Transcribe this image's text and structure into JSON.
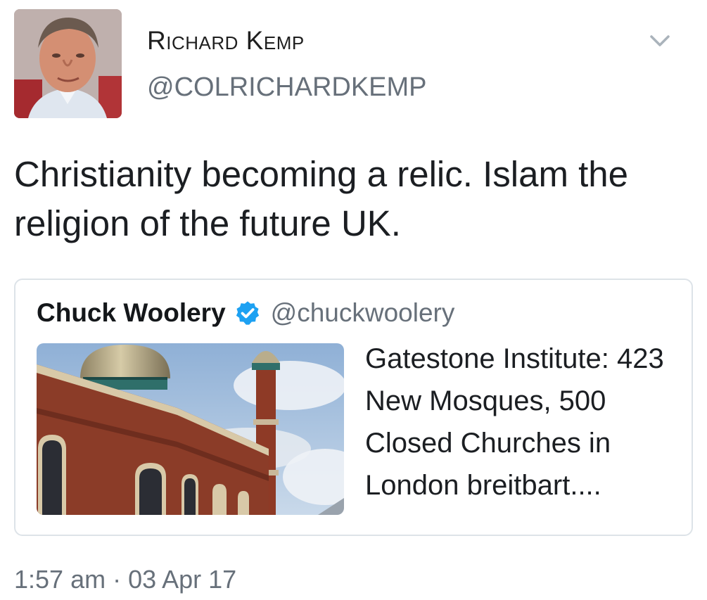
{
  "tweet": {
    "author": {
      "name": "Richard Kemp",
      "handle": "@COLRICHARDKEMP"
    },
    "text": "Christianity becoming a relic. Islam the religion of the future UK.",
    "timestamp": "1:57 am · 03 Apr 17",
    "menu_icon": "chevron-down-icon",
    "quoted": {
      "name": "Chuck Woolery",
      "verified": true,
      "verified_icon": "verified-badge-icon",
      "handle": "@chuckwoolery",
      "link_text": "Gatestone Institute: 423 New Mosques, 500 Closed Churches in London breitbart....",
      "image_subject": "mosque-photo"
    }
  },
  "colors": {
    "verified_blue": "#1da1f2",
    "secondary_text": "#67707a",
    "card_border": "#dde3e8"
  }
}
